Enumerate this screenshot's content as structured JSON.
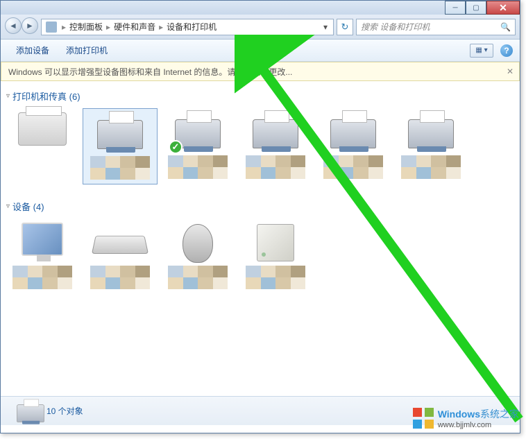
{
  "breadcrumb": {
    "b1": "控制面板",
    "b2": "硬件和声音",
    "b3": "设备和打印机"
  },
  "search": {
    "placeholder": "搜索 设备和打印机"
  },
  "toolbar": {
    "add_device": "添加设备",
    "add_printer": "添加打印机"
  },
  "infobar": {
    "text": "Windows 可以显示增强型设备图标和来自 Internet 的信息。请单击进行更改..."
  },
  "groups": {
    "printers": {
      "title": "打印机和传真 (6)"
    },
    "devices": {
      "title": "设备 (4)"
    }
  },
  "status": {
    "count": "10 个对象"
  },
  "watermark": {
    "brand": "Windows",
    "suffix": "系统之家",
    "url": "www.bjjmlv.com"
  }
}
